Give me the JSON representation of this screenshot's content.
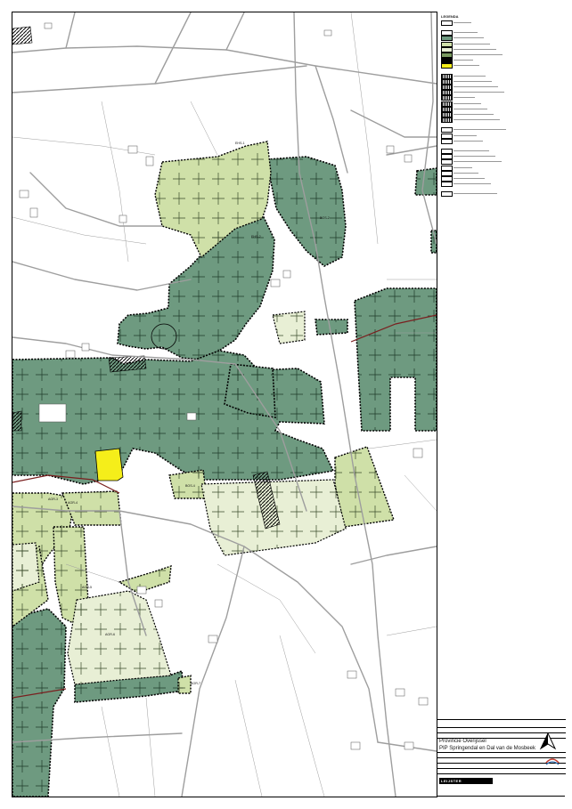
{
  "legend": {
    "title": "LEGENDA"
  },
  "colors": {
    "forest_dark": "#6e9a80",
    "forest_line": "#4e7a62",
    "green_light": "#cfe0a8",
    "green_pale": "#e8efd5",
    "yellow_plot": "#f5ee1a",
    "road": "#9e9e9e",
    "river": "#7a1f1f",
    "boundary": "#000000"
  },
  "map": {
    "labels": [
      {
        "text": "EHS-1"
      },
      {
        "text": "BOS-2"
      },
      {
        "text": "EHS-2"
      },
      {
        "text": "AGR-3"
      },
      {
        "text": "AGR-4"
      },
      {
        "text": "AGR-5"
      },
      {
        "text": "AGR-6"
      },
      {
        "text": "BOS-4"
      },
      {
        "text": "AGR-7"
      }
    ]
  },
  "title_block": {
    "client": "Provincie Overijssel",
    "project": "PIP Springendal en Dal van de Mosbeek",
    "company": "LEIJSTER"
  },
  "icons": {
    "north": "north-arrow-icon",
    "logo": "province-logo-icon"
  }
}
